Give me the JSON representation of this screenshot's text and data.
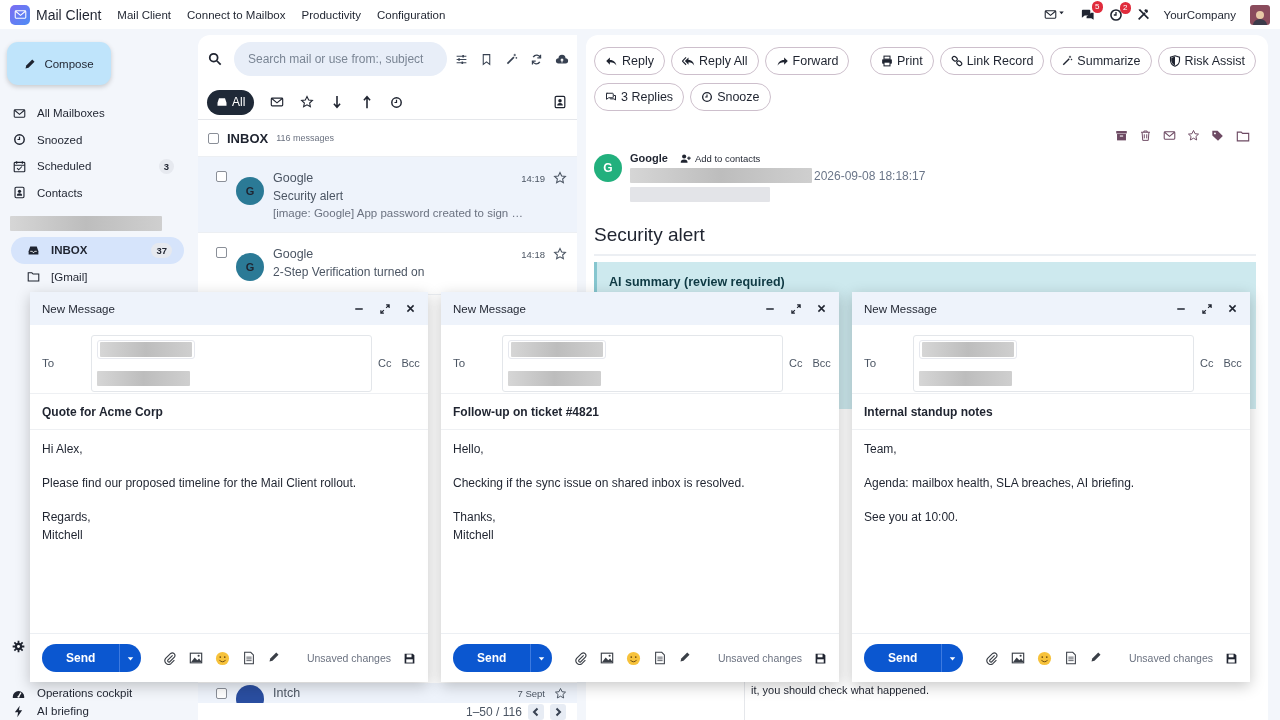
{
  "topbar": {
    "logo_text": "Mail Client",
    "menu": [
      {
        "label": "Mail Client"
      },
      {
        "label": "Connect to Mailbox"
      },
      {
        "label": "Productivity"
      },
      {
        "label": "Configuration"
      }
    ],
    "chat_badge": "5",
    "activity_badge": "2",
    "company": "YourCompany"
  },
  "sidebar": {
    "compose": "Compose",
    "nav": [
      {
        "label": "All Mailboxes",
        "selected": false
      },
      {
        "label": "Snoozed",
        "selected": false
      },
      {
        "label": "Scheduled",
        "count": "3",
        "selected": false
      },
      {
        "label": "Contacts",
        "selected": false
      }
    ],
    "folders": [
      {
        "label": "INBOX",
        "count": "37",
        "selected": true
      },
      {
        "label": "[Gmail]",
        "selected": false
      }
    ],
    "bottom": [
      {
        "label": "Operations cockpit"
      },
      {
        "label": "AI briefing"
      }
    ]
  },
  "list": {
    "search_placeholder": "Search mail or use from:, subject",
    "filters": [
      {
        "label": "All",
        "selected": true
      }
    ],
    "folder": "INBOX",
    "count": "116 messages",
    "all_checked": false,
    "rows": [
      {
        "sender": "Google",
        "initial": "G",
        "time": "14:19",
        "subject": "Security alert",
        "preview": "[image: Google] App password created to sign …",
        "selected": true,
        "checked": false
      },
      {
        "sender": "Google",
        "initial": "G",
        "time": "14:18",
        "subject": "2-Step Verification turned on",
        "selected": false,
        "checked": false
      }
    ],
    "last_row": {
      "sender": "Intch",
      "time": "7 Sept",
      "checked": false
    },
    "pager": "1–50 / 116"
  },
  "reader": {
    "actions": [
      {
        "label": "Reply"
      },
      {
        "label": "Reply All"
      },
      {
        "label": "Forward"
      }
    ],
    "tools": [
      {
        "label": "Print"
      },
      {
        "label": "Link Record"
      },
      {
        "label": "Summarize"
      },
      {
        "label": "Risk Assist"
      }
    ],
    "actions2": [
      {
        "label": "3 Replies"
      },
      {
        "label": "Snooze"
      }
    ],
    "sender": "Google",
    "initial": "G",
    "add_contact": "Add to contacts",
    "date": "2026-09-08 18:18:17",
    "subject": "Security alert",
    "summary_title": "AI summary (review required)",
    "body_tail": "it, you should check what happened."
  },
  "composes": [
    {
      "title": "New Message",
      "to_label": "To",
      "cc": "Cc",
      "bcc": "Bcc",
      "subject": "Quote for Acme Corp",
      "body": [
        [
          "Hi Alex,"
        ],
        [
          "Please find our proposed timeline for the Mail Client rollout."
        ],
        [
          "Regards,",
          "Mitchell"
        ]
      ],
      "send": "Send",
      "status": "Unsaved changes"
    },
    {
      "title": "New Message",
      "to_label": "To",
      "cc": "Cc",
      "bcc": "Bcc",
      "subject": "Follow-up on ticket #4821",
      "body": [
        [
          "Hello,"
        ],
        [
          "Checking if the sync issue on shared inbox is resolved."
        ],
        [
          "Thanks,",
          "Mitchell"
        ]
      ],
      "send": "Send",
      "status": "Unsaved changes"
    },
    {
      "title": "New Message",
      "to_label": "To",
      "cc": "Cc",
      "bcc": "Bcc",
      "subject": "Internal standup notes",
      "body": [
        [
          "Team,"
        ],
        [
          "Agenda: mailbox health, SLA breaches, AI briefing."
        ],
        [
          "See you at 10:00."
        ]
      ],
      "send": "Send",
      "status": "Unsaved changes"
    }
  ]
}
